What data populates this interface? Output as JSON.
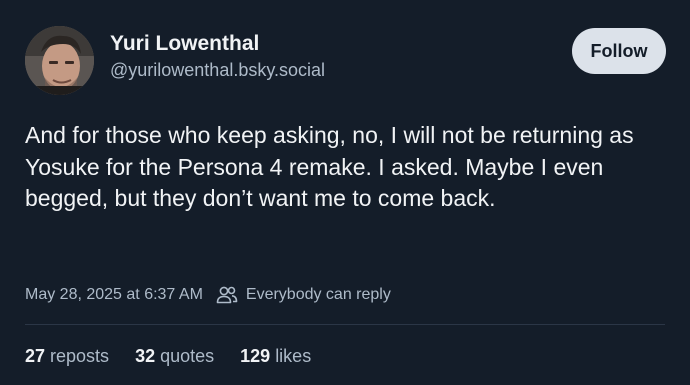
{
  "post": {
    "author": {
      "display_name": "Yuri Lowenthal",
      "handle": "@yurilowenthal.bsky.social",
      "avatar_icon": "avatar-photo"
    },
    "follow_label": "Follow",
    "text": "And for those who keep asking, no, I will not be returning as Yosuke for the Persona 4 remake. I asked. Maybe I even begged, but they don’t want me to come back.",
    "timestamp": "May 28, 2025 at 6:37 AM",
    "reply_icon": "people-icon",
    "reply_setting": "Everybody can reply",
    "stats": {
      "reposts_count": "27",
      "reposts_label": "reposts",
      "quotes_count": "32",
      "quotes_label": "quotes",
      "likes_count": "129",
      "likes_label": "likes"
    }
  },
  "colors": {
    "background": "#141d29",
    "text_primary": "#f1f3f5",
    "text_secondary": "#aebbc9",
    "button_bg": "#dce2ea",
    "divider": "#2b3646"
  }
}
